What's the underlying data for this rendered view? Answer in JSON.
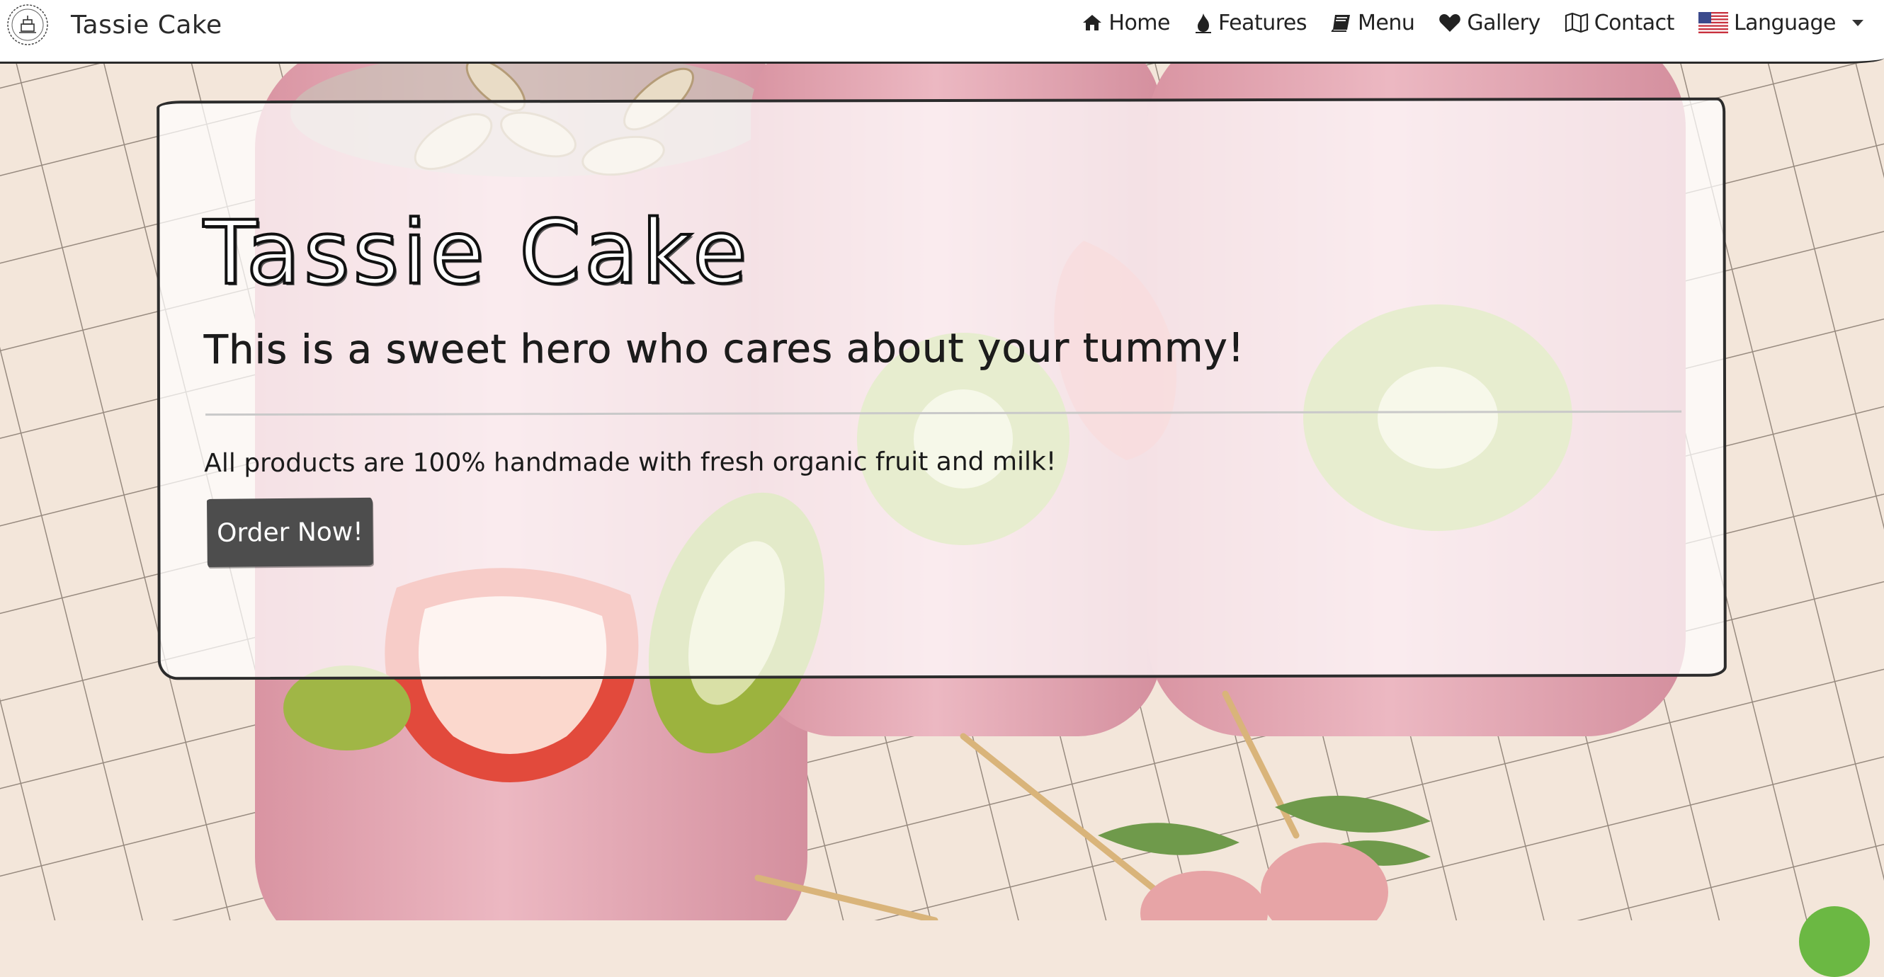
{
  "brand": {
    "name": "Tassie Cake",
    "logo_icon": "cake-badge-icon"
  },
  "nav": {
    "items": [
      {
        "label": "Home",
        "icon": "home-icon"
      },
      {
        "label": "Features",
        "icon": "fire-icon"
      },
      {
        "label": "Menu",
        "icon": "book-icon"
      },
      {
        "label": "Gallery",
        "icon": "heart-icon"
      },
      {
        "label": "Contact",
        "icon": "map-icon"
      },
      {
        "label": "Language",
        "icon": "us-flag-icon"
      }
    ]
  },
  "hero": {
    "title": "Tassie Cake",
    "subtitle": "This is a sweet hero who cares about your tummy!",
    "lead": "All products are 100% handmade with fresh organic fruit and milk!",
    "cta_label": "Order Now!"
  },
  "colors": {
    "nav_bg": "#ffffff",
    "button_bg": "#4d4d4d",
    "chat_bubble": "#6bb843",
    "smoothie_pink": "#e6aeb8"
  }
}
